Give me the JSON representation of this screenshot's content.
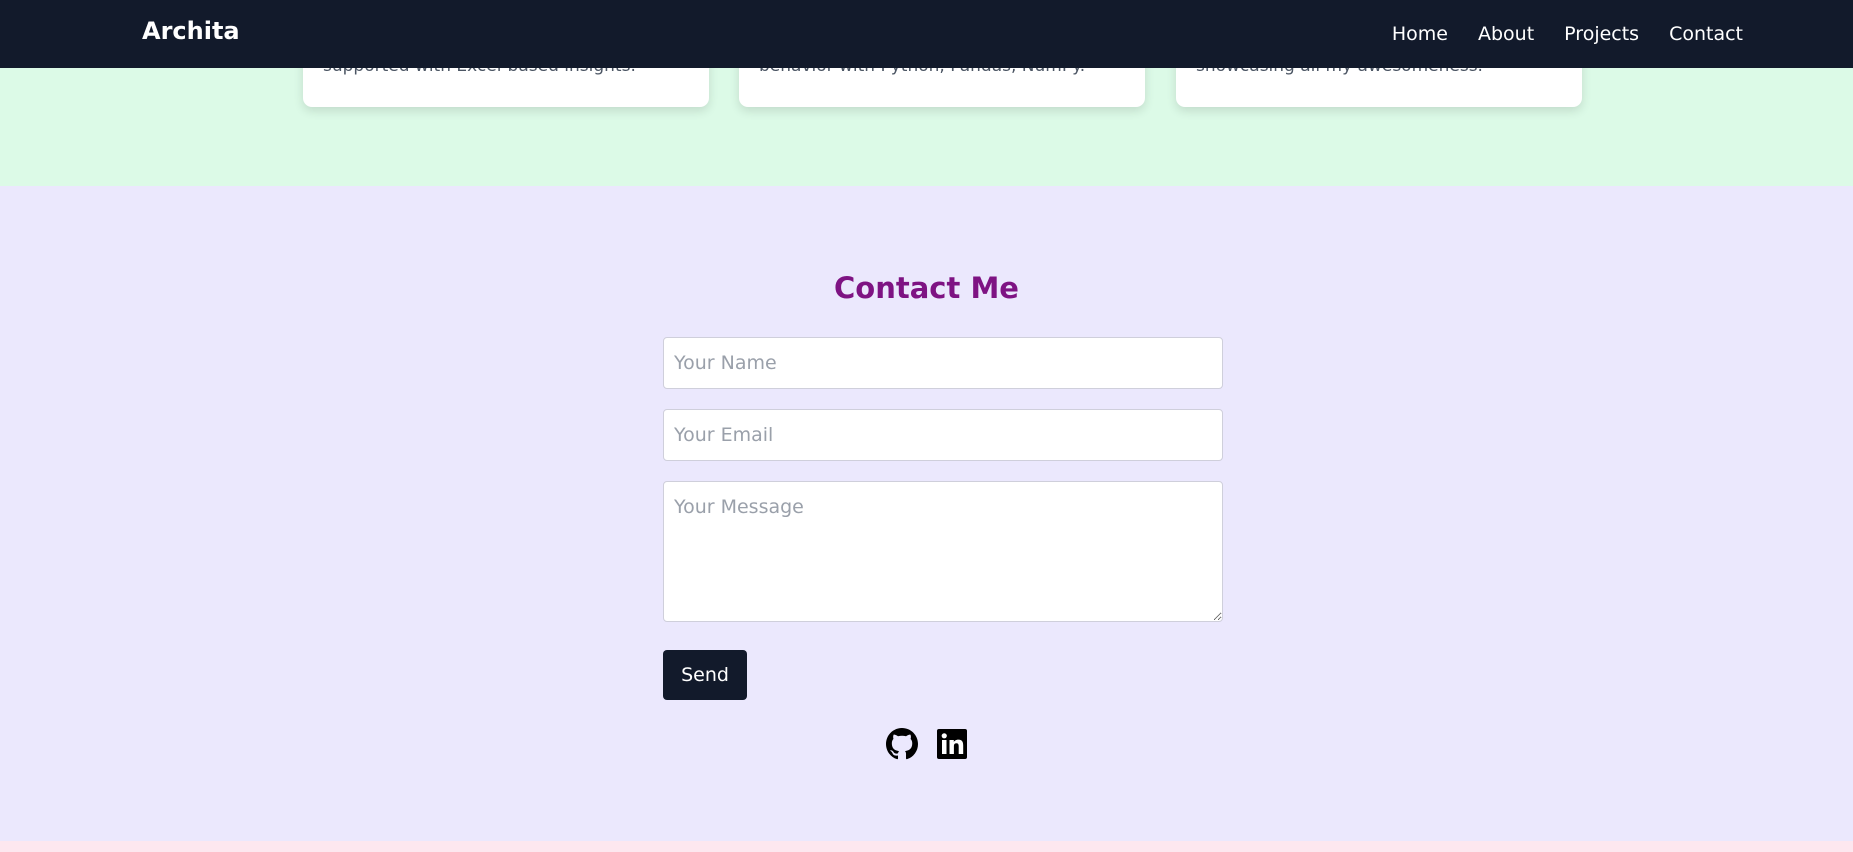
{
  "navbar": {
    "brand": "Archita",
    "links": [
      "Home",
      "About",
      "Projects",
      "Contact"
    ]
  },
  "projects": {
    "cards": [
      {
        "text": "supported with Excel-based insights."
      },
      {
        "text": "behavior with Python, Pandas, NumPy."
      },
      {
        "text": "showcasing all my awesomeness."
      }
    ]
  },
  "contact": {
    "title": "Contact Me",
    "name_placeholder": "Your Name",
    "email_placeholder": "Your Email",
    "message_placeholder": "Your Message",
    "send_label": "Send",
    "social_icons": [
      "github-icon",
      "linkedin-icon"
    ]
  },
  "colors": {
    "navbar_bg": "#121a2b",
    "projects_bg": "#dcfae7",
    "contact_bg": "#ebe8fd",
    "title_color": "#7e1383",
    "button_bg": "#121a2b",
    "footer_strip": "#fde7ef"
  }
}
